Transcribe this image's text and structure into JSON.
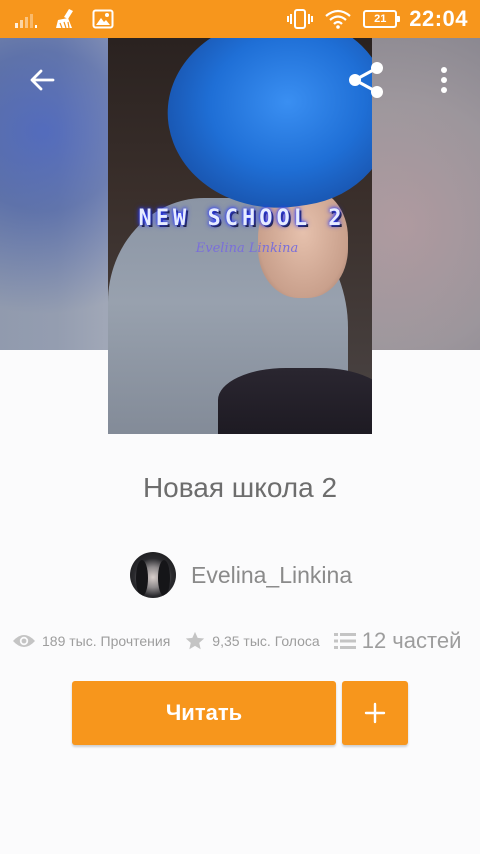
{
  "status_bar": {
    "time": "22:04",
    "battery": "21",
    "colors": {
      "background": "#f7961c"
    },
    "icons": [
      "signal-icon",
      "cleaner-icon",
      "image-notification-icon",
      "vibrate-icon",
      "wifi-icon",
      "battery-icon"
    ]
  },
  "toolbar": {
    "icons": [
      "back-arrow-icon",
      "share-icon",
      "more-vert-icon"
    ]
  },
  "cover": {
    "title": "NEW SCHOOL 2",
    "subtitle": "Evelina Linkina"
  },
  "story": {
    "title": "Новая школа 2",
    "author": "Evelina_Linkina"
  },
  "stats": {
    "reads": "189 тыс. Прочтения",
    "votes": "9,35 тыс. Голоса",
    "parts": "12 частей"
  },
  "actions": {
    "read_label": "Читать",
    "add_icon": "plus-icon",
    "accent": "#f7961c"
  }
}
